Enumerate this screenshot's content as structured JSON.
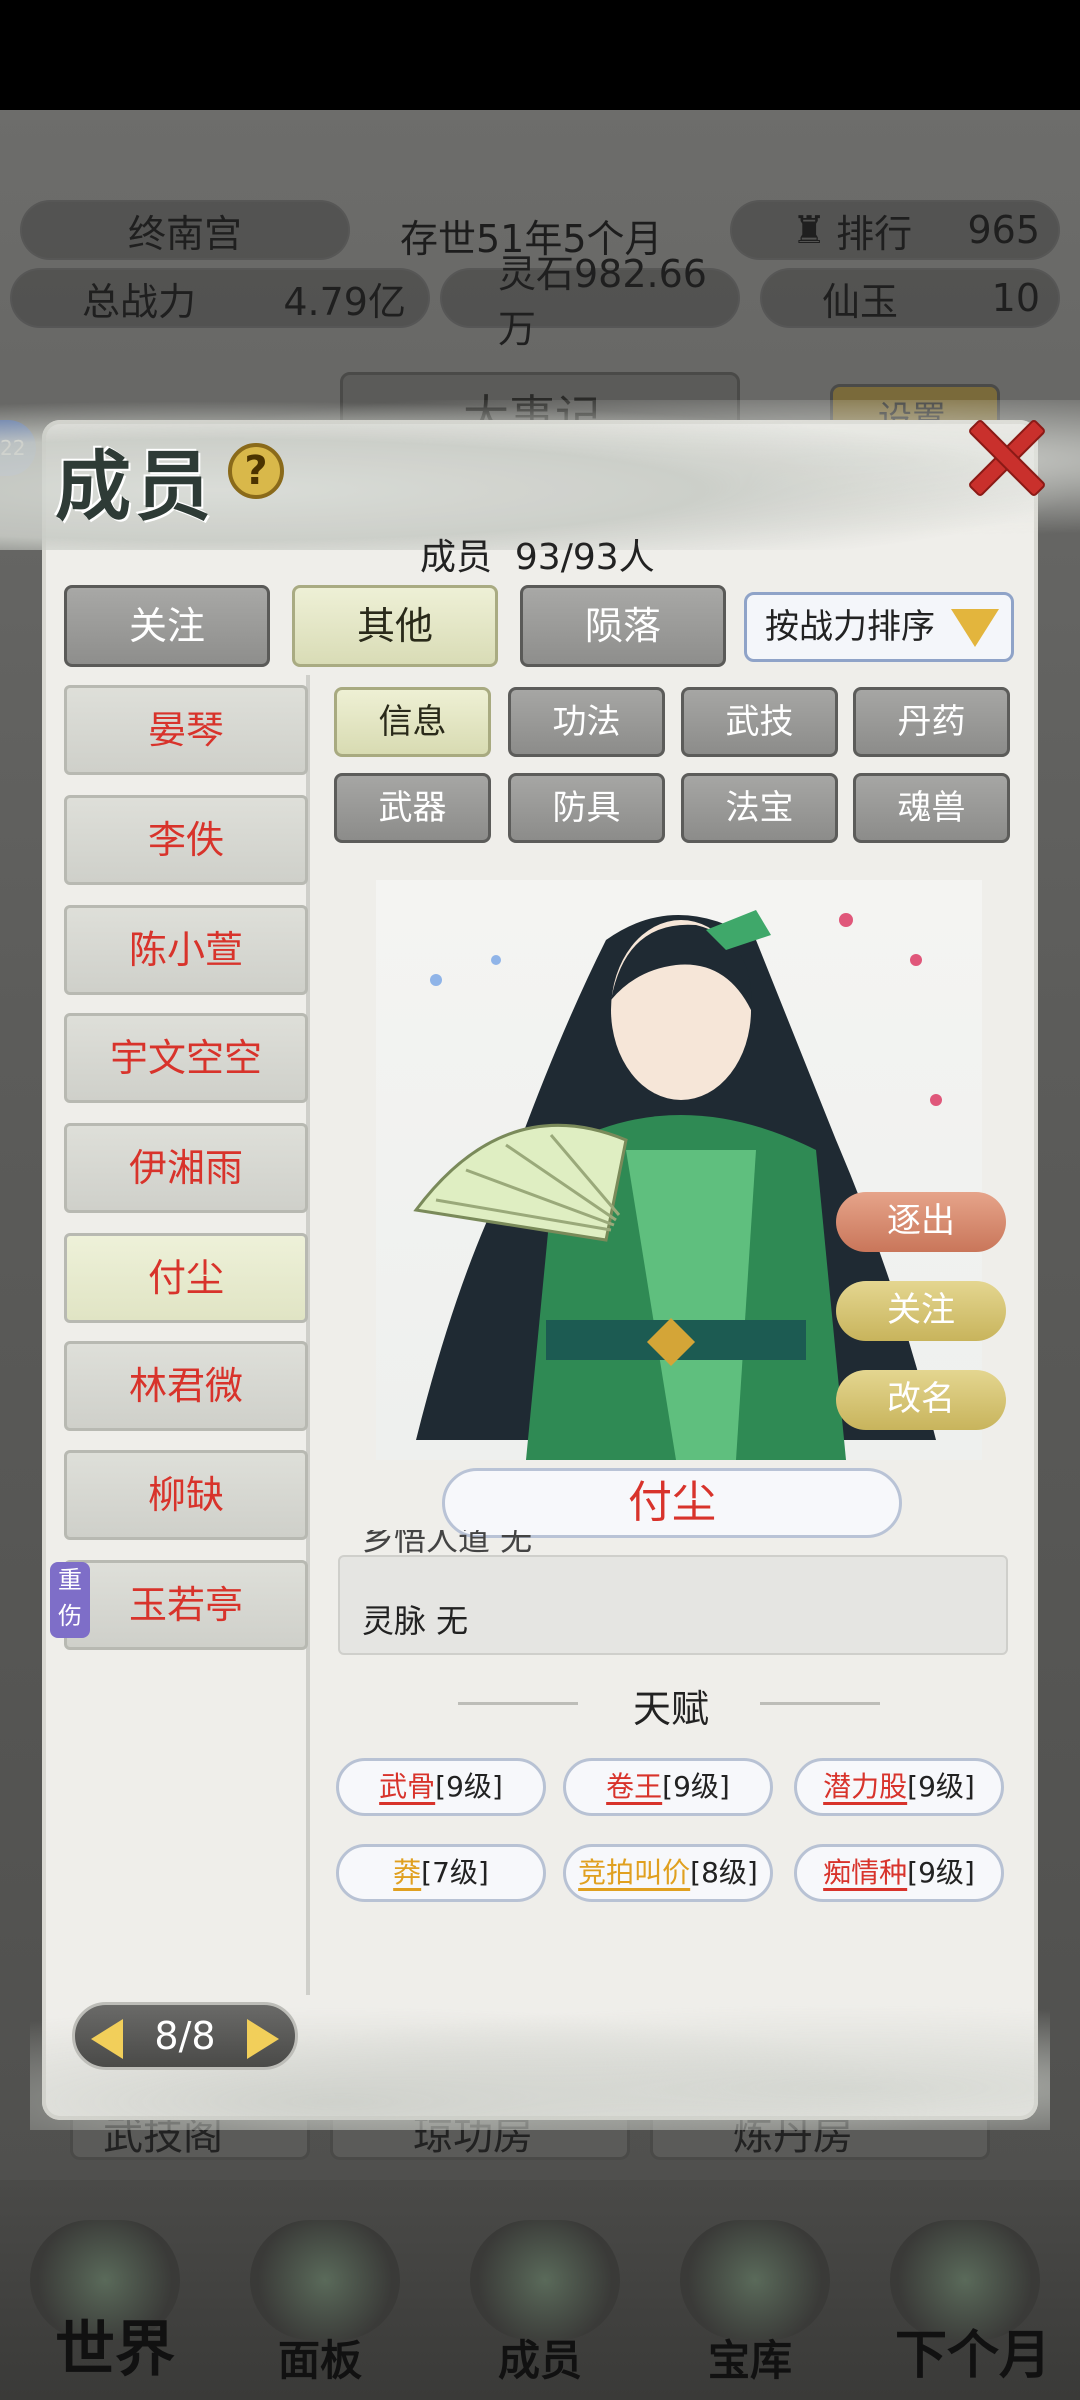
{
  "hud": {
    "sect_name": "终南宫",
    "existence": "存世51年5个月",
    "rank_label": "排行",
    "rank_value": "965",
    "power_label": "总战力",
    "power_value": "4.79亿",
    "spirit_stone": "灵石982.66万",
    "jade_label": "仙玉",
    "jade_value": "10",
    "bg_center_label": "大事记",
    "bg_settings_label": "设置",
    "badge_count": "22"
  },
  "dialog": {
    "title": "成员",
    "help_symbol": "?",
    "member_count_label": "成员",
    "member_count": "93/93人",
    "tabs": [
      {
        "label": "关注",
        "active": false
      },
      {
        "label": "其他",
        "active": true
      },
      {
        "label": "陨落",
        "active": false
      }
    ],
    "sort_label": "按战力排序",
    "members": [
      {
        "name": "晏琴"
      },
      {
        "name": "李佚"
      },
      {
        "name": "陈小萱"
      },
      {
        "name": "宇文空空"
      },
      {
        "name": "伊湘雨"
      },
      {
        "name": "付尘",
        "selected": true
      },
      {
        "name": "林君微"
      },
      {
        "name": "柳缺"
      },
      {
        "name": "玉若亭",
        "status": "重伤"
      }
    ],
    "subtabs": [
      "信息",
      "功法",
      "武技",
      "丹药",
      "武器",
      "防具",
      "法宝",
      "魂兽"
    ],
    "active_subtab": "信息",
    "actions": {
      "expel": "逐出",
      "follow": "关注",
      "rename": "改名"
    },
    "selected_name": "付尘",
    "info_cut_line": "乡悟人道 无",
    "info_line": "灵脉 无",
    "talent_title": "天赋",
    "talents": [
      {
        "name": "武骨",
        "level": "[9级]",
        "color": "#d8332b"
      },
      {
        "name": "卷王",
        "level": "[9级]",
        "color": "#d8332b"
      },
      {
        "name": "潜力股",
        "level": "[9级]",
        "color": "#d8332b"
      },
      {
        "name": "莽",
        "level": "[7级]",
        "color": "#e0a020"
      },
      {
        "name": "竞拍叫价",
        "level": "[8级]",
        "color": "#e0a020"
      },
      {
        "name": "痴情种",
        "level": "[9级]",
        "color": "#d8332b"
      }
    ],
    "pager": "8/8"
  },
  "nav": {
    "items": [
      "世界",
      "面板",
      "成员",
      "宝库",
      "下个月"
    ],
    "bg_items": [
      "武技阁",
      "琼功房",
      "炼丹房"
    ]
  },
  "colors": {
    "accent_red": "#d8332b",
    "gold": "#e0a020",
    "expel": "#d98a6e",
    "follow": "#cfc07a"
  }
}
